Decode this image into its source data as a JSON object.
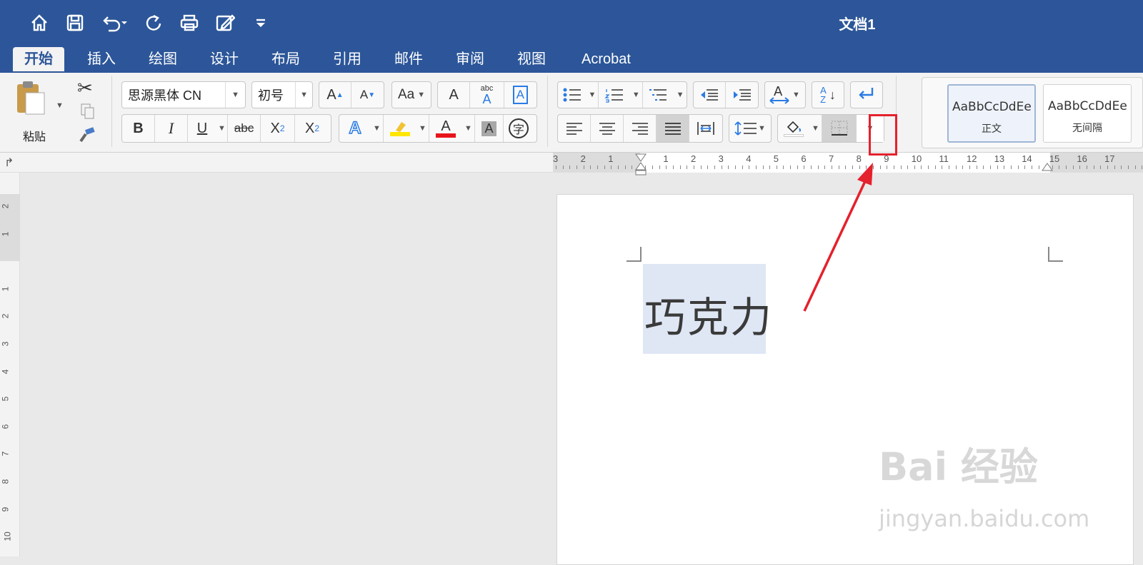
{
  "window": {
    "title": "文档1"
  },
  "quick_access": {
    "icons": [
      "home-icon",
      "save-icon",
      "undo-icon",
      "redo-icon",
      "print-icon",
      "edit-icon",
      "customize-icon"
    ]
  },
  "tabs": [
    {
      "label": "开始",
      "active": true
    },
    {
      "label": "插入"
    },
    {
      "label": "绘图"
    },
    {
      "label": "设计"
    },
    {
      "label": "布局"
    },
    {
      "label": "引用"
    },
    {
      "label": "邮件"
    },
    {
      "label": "审阅"
    },
    {
      "label": "视图"
    },
    {
      "label": "Acrobat"
    }
  ],
  "clipboard": {
    "paste_label": "粘贴"
  },
  "font": {
    "family": "思源黑体 CN",
    "size": "初号",
    "bold": "B",
    "italic": "I",
    "underline": "U",
    "strike": "abc",
    "subscript": "X",
    "subscript_small": "2",
    "superscript": "X",
    "superscript_small": "2",
    "text_effect": "A",
    "highlight_color": "#ffe600",
    "font_color": "#e8141b",
    "font_color_label": "A",
    "shading_label": "A",
    "enclose_label": "字",
    "grow_label": "A",
    "shrink_label": "A",
    "case_label": "Aa",
    "clear_label": "A",
    "phonetic_top": "abc",
    "phonetic_bottom": "A",
    "border_char": "A"
  },
  "paragraph": {
    "sort_top": "A",
    "sort_bottom": "Z"
  },
  "styles": [
    {
      "sample": "AaBbCcDdEe",
      "name": "正文",
      "selected": true
    },
    {
      "sample": "AaBbCcDdEe",
      "name": "无间隔"
    }
  ],
  "ruler": {
    "horizontal": [
      "3",
      "2",
      "1",
      "1",
      "2",
      "3",
      "4",
      "5",
      "6",
      "7",
      "8",
      "9",
      "10",
      "11",
      "12",
      "13",
      "14",
      "15",
      "16",
      "17"
    ],
    "vertical": [
      "2",
      "1",
      "1",
      "2",
      "3",
      "4",
      "5",
      "6",
      "7",
      "8",
      "9",
      "10"
    ]
  },
  "document": {
    "text": "巧克力"
  },
  "watermark": {
    "brand": "Bai 经验",
    "url": "jingyan.baidu.com"
  },
  "colors": {
    "accent": "#2c5699",
    "annotation": "#e4212c",
    "selection": "#dfe6f4"
  }
}
